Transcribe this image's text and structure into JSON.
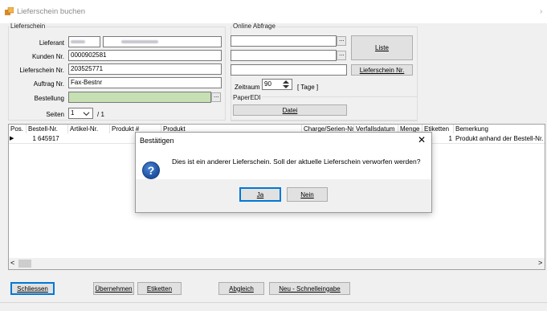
{
  "window": {
    "title": "Lieferschein buchen",
    "icon": "app-icon",
    "chevron": "›"
  },
  "lieferschein": {
    "group_label": "Lieferschein",
    "lieferant_label": "Lieferant",
    "kunden_label": "Kunden Nr.",
    "kunden_value": "0000902581",
    "lieferschein_label": "Lieferschein Nr.",
    "lieferschein_value": "203525771",
    "auftrag_label": "Auftrag Nr.",
    "auftrag_value": "Fax-Bestnr",
    "bestellung_label": "Bestellung",
    "seiten_label": "Seiten",
    "seiten_value": "1",
    "seiten_total": "/ 1",
    "ellipsis": "···",
    "highlight_color": "#c6e0b4"
  },
  "online": {
    "group_label": "Online Abfrage",
    "ellipsis": "···",
    "liste_label": "Liste",
    "lieferschein_nr_button": "Lieferschein Nr.",
    "zeitraum_label": "Zeitraum",
    "zeitraum_value": "90",
    "zeitraum_unit": "[ Tage ]",
    "paperedi_label": "PaperEDI",
    "datei_button": "Datei"
  },
  "grid": {
    "columns": [
      "Pos.",
      "Bestell-Nr.",
      "Artikel-Nr.",
      "Produkt #",
      "Produkt",
      "Charge/Serien-Nr.",
      "Verfallsdatum",
      "Menge",
      "Etiketten",
      "Bemerkung"
    ],
    "row": {
      "marker": "▶",
      "pos": "1",
      "bestell": "645917",
      "etiketten": "1",
      "bemerkung": "Produkt anhand der Bestell-Nr."
    },
    "scroll_left": "<",
    "scroll_right": ">"
  },
  "toolbar": {
    "schliessen": "Schliessen",
    "uebernehmen": "Übernehmen",
    "etiketten": "Etiketten",
    "abgleich": "Abgleich",
    "schnelleingabe": "Neu - Schnelleingabe"
  },
  "dialog": {
    "title": "Bestätigen",
    "close": "✕",
    "icon_glyph": "?",
    "message": "Dies ist ein anderer Lieferschein. Soll der aktuelle Lieferschein verworfen werden?",
    "yes": "Ja",
    "no": "Nein"
  },
  "colors": {
    "accent": "#0078d7",
    "question_icon": "#1d4f9c"
  }
}
